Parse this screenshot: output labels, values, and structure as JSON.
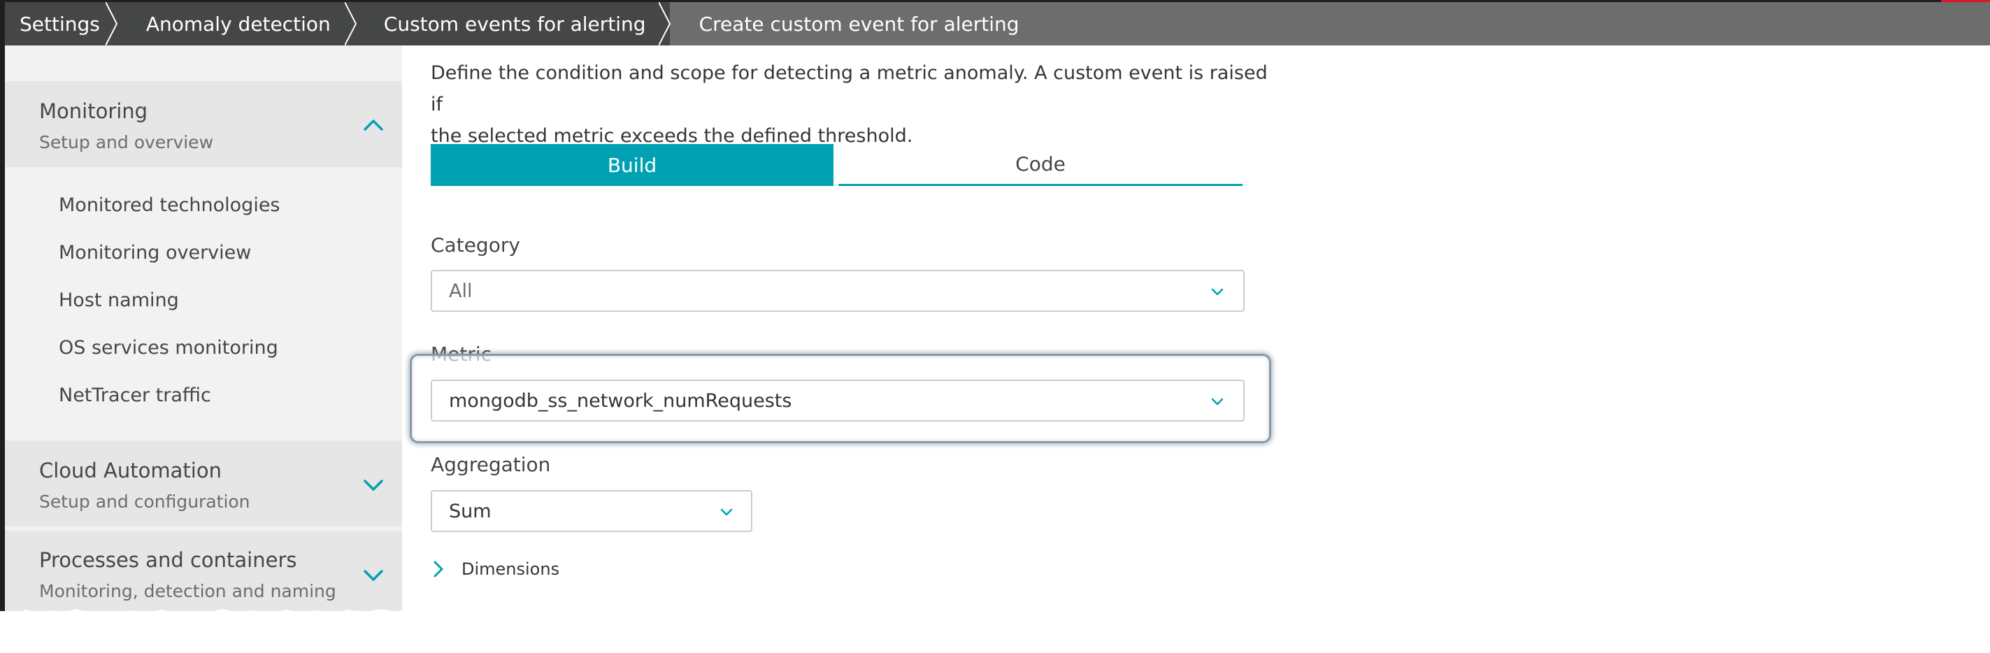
{
  "breadcrumb": {
    "items": [
      "Settings",
      "Anomaly detection",
      "Custom events for alerting"
    ],
    "current": "Create custom event for alerting"
  },
  "sidebar": {
    "sections": [
      {
        "title": "Monitoring",
        "subtitle": "Setup and overview",
        "expanded": true
      },
      {
        "title": "Cloud Automation",
        "subtitle": "Setup and configuration",
        "expanded": false
      },
      {
        "title": "Processes and containers",
        "subtitle": "Monitoring, detection and naming",
        "expanded": false
      }
    ],
    "items": [
      "Monitored technologies",
      "Monitoring overview",
      "Host naming",
      "OS services monitoring",
      "NetTracer traffic"
    ]
  },
  "main": {
    "intro_line1": "Define the condition and scope for detecting a metric anomaly. A custom event is raised if",
    "intro_line2": "the selected metric exceeds the defined threshold.",
    "tabs": {
      "build": "Build",
      "code": "Code",
      "active": "Build"
    },
    "category": {
      "label": "Category",
      "value": "All"
    },
    "metric": {
      "label": "Metric",
      "value": "mongodb_ss_network_numRequests"
    },
    "aggregation": {
      "label": "Aggregation",
      "value": "Sum"
    },
    "dimensions": {
      "label": "Dimensions"
    }
  },
  "colors": {
    "accent": "#00a1b2",
    "breadcrumb_dark": "#454646",
    "breadcrumb_light": "#6d6d6d",
    "sidebar_bg": "#f2f2f2",
    "section_bg": "#e6e6e6",
    "brand_red": "#dc172a"
  },
  "icons": {
    "breadcrumb_separator": "chevron-right-icon",
    "section_expanded": "chevron-up-icon",
    "section_collapsed": "chevron-down-icon",
    "select_chevron": "chevron-down-icon",
    "dimensions_toggle": "chevron-right-icon"
  }
}
